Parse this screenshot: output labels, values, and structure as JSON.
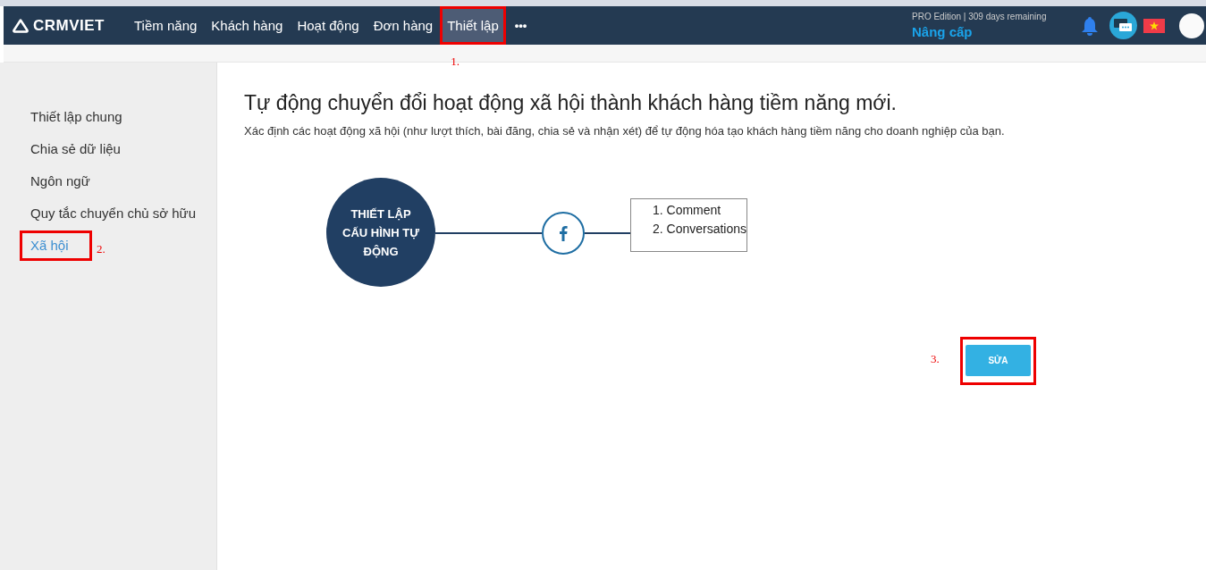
{
  "brand": {
    "name": "CRMVIET"
  },
  "nav": [
    {
      "label": "Tiềm năng",
      "selected": false
    },
    {
      "label": "Khách hàng",
      "selected": false
    },
    {
      "label": "Hoạt động",
      "selected": false
    },
    {
      "label": "Đơn hàng",
      "selected": false
    },
    {
      "label": "Thiết lập",
      "selected": true,
      "annotation": "1."
    }
  ],
  "more": "•••",
  "edition": "PRO Edition | 309 days remaining",
  "upgrade": "Nâng cấp",
  "sidebar": [
    {
      "label": "Thiết lập chung",
      "selected": false
    },
    {
      "label": "Chia sẻ dữ liệu",
      "selected": false
    },
    {
      "label": "Ngôn ngữ",
      "selected": false
    },
    {
      "label": "Quy tắc chuyển chủ sở hữu",
      "selected": false
    },
    {
      "label": "Xã hội",
      "selected": true,
      "annotation": "2."
    }
  ],
  "heading": "Tự động chuyển đổi hoạt động xã hội thành khách hàng tiềm năng mới.",
  "description": "Xác định các hoạt động xã hội (như lượt thích, bài đăng, chia sẻ và nhận xét) để tự động hóa tạo khách hàng tiềm năng cho doanh nghiệp của bạn.",
  "diagram": {
    "node": "THIẾT LẬP CẤU HÌNH TỰ ĐỘNG",
    "activities": [
      "1. Comment",
      "2. Conversations"
    ]
  },
  "edit_button": {
    "label": "SỬA",
    "annotation": "3."
  }
}
